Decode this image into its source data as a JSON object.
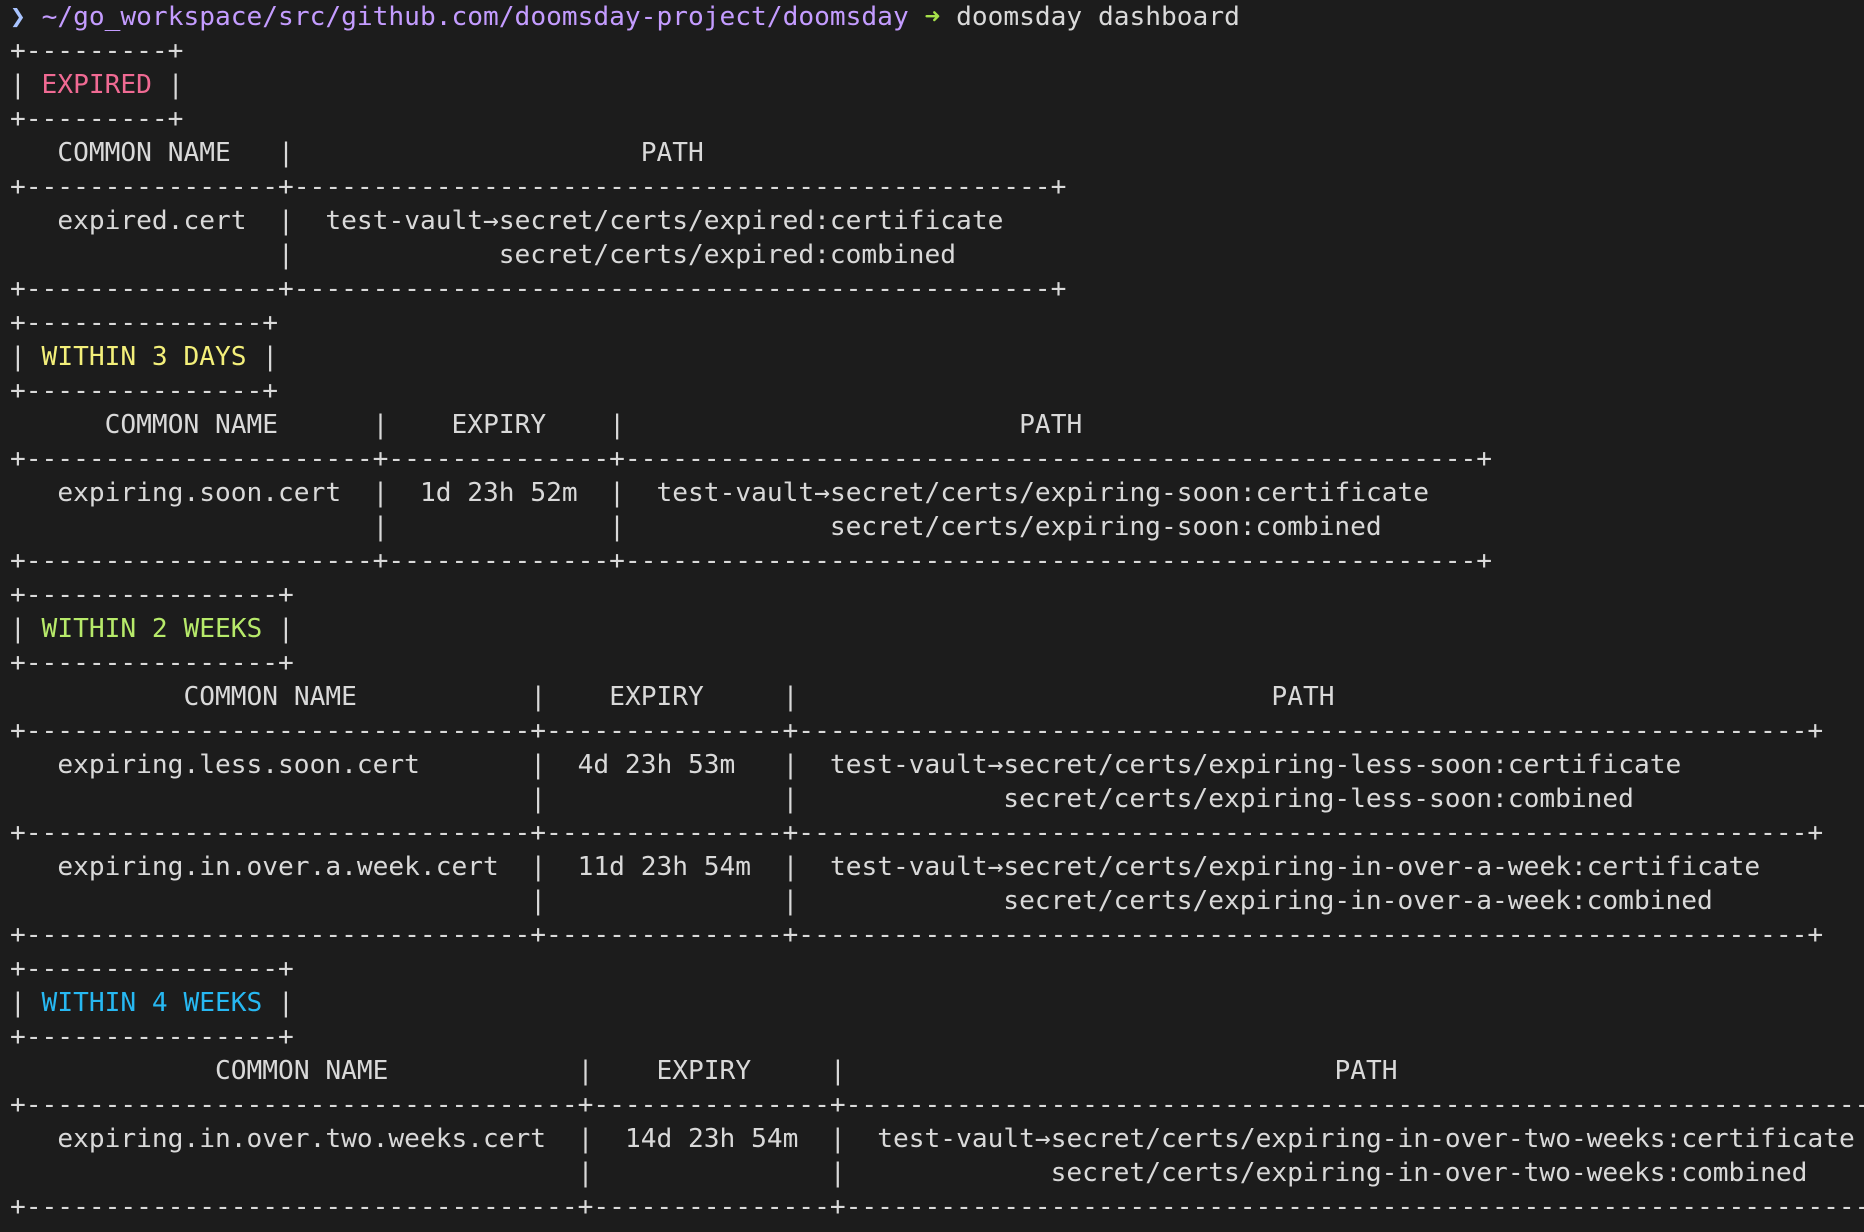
{
  "prompt": {
    "caret": "❯",
    "path": "~/go_workspace/src/github.com/doomsday-project/doomsday",
    "arrow": "➜",
    "command": "doomsday dashboard"
  },
  "colors": {
    "background": "#1c1c1c",
    "text": "#d9d9d9",
    "prompt_path": "#c49cff",
    "prompt_arrow": "#a6e04a",
    "expired": "#f06a93",
    "within_3_days": "#f3ef7a",
    "within_2_weeks": "#b7ea6a",
    "within_4_weeks": "#27b8f2"
  },
  "sections": [
    {
      "title": "EXPIRED",
      "color": "#f06a93",
      "headers": [
        "COMMON NAME",
        "PATH"
      ],
      "rows": [
        {
          "common_name": "expired.cert",
          "backend": "test-vault",
          "paths": [
            "secret/certs/expired:certificate",
            "secret/certs/expired:combined"
          ]
        }
      ]
    },
    {
      "title": "WITHIN 3 DAYS",
      "color": "#f3ef7a",
      "headers": [
        "COMMON NAME",
        "EXPIRY",
        "PATH"
      ],
      "rows": [
        {
          "common_name": "expiring.soon.cert",
          "expiry": "1d 23h 52m",
          "backend": "test-vault",
          "paths": [
            "secret/certs/expiring-soon:certificate",
            "secret/certs/expiring-soon:combined"
          ]
        }
      ]
    },
    {
      "title": "WITHIN 2 WEEKS",
      "color": "#b7ea6a",
      "headers": [
        "COMMON NAME",
        "EXPIRY",
        "PATH"
      ],
      "rows": [
        {
          "common_name": "expiring.less.soon.cert",
          "expiry": "4d 23h 53m",
          "backend": "test-vault",
          "paths": [
            "secret/certs/expiring-less-soon:certificate",
            "secret/certs/expiring-less-soon:combined"
          ]
        },
        {
          "common_name": "expiring.in.over.a.week.cert",
          "expiry": "11d 23h 54m",
          "backend": "test-vault",
          "paths": [
            "secret/certs/expiring-in-over-a-week:certificate",
            "secret/certs/expiring-in-over-a-week:combined"
          ]
        }
      ]
    },
    {
      "title": "WITHIN 4 WEEKS",
      "color": "#27b8f2",
      "headers": [
        "COMMON NAME",
        "EXPIRY",
        "PATH"
      ],
      "rows": [
        {
          "common_name": "expiring.in.over.two.weeks.cert",
          "expiry": "14d 23h 54m",
          "backend": "test-vault",
          "paths": [
            "secret/certs/expiring-in-over-two-weeks:certificate",
            "secret/certs/expiring-in-over-two-weeks:combined"
          ]
        }
      ]
    }
  ]
}
